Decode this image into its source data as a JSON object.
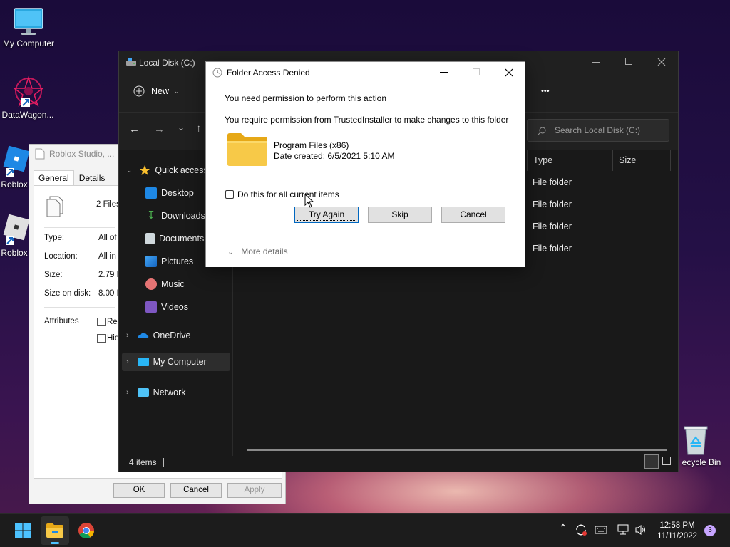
{
  "desktop": {
    "icons": [
      {
        "label": "My Computer"
      },
      {
        "label": "DataWagon..."
      },
      {
        "label": "Roblox"
      },
      {
        "label": "Roblox"
      },
      {
        "label": "ecycle Bin"
      }
    ]
  },
  "properties_dialog": {
    "title": "Roblox Studio, ...",
    "tabs": [
      "General",
      "Details"
    ],
    "summary": "2 Files,",
    "rows": [
      {
        "label": "Type:",
        "value": "All of t"
      },
      {
        "label": "Location:",
        "value": "All in C"
      },
      {
        "label": "Size:",
        "value": "2.79 K"
      },
      {
        "label": "Size on disk:",
        "value": "8.00 K"
      }
    ],
    "attributes_label": "Attributes",
    "attr_readonly": "Rea",
    "attr_hidden": "Hidd",
    "buttons": {
      "ok": "OK",
      "cancel": "Cancel",
      "apply": "Apply"
    }
  },
  "explorer": {
    "title": "Local Disk (C:)",
    "toolbar": {
      "new_label": "New",
      "more_label": "•••"
    },
    "search_placeholder": "Search Local Disk (C:)",
    "columns": {
      "type": "Type",
      "size": "Size"
    },
    "rows": [
      {
        "type": "File folder"
      },
      {
        "type": "File folder"
      },
      {
        "type": "File folder"
      },
      {
        "type": "File folder"
      }
    ],
    "sidebar": {
      "quick_access": "Quick access",
      "items": [
        "Desktop",
        "Downloads",
        "Documents",
        "Pictures",
        "Music",
        "Videos"
      ],
      "onedrive": "OneDrive",
      "my_computer": "My Computer",
      "network": "Network"
    },
    "status": "4 items"
  },
  "dialog": {
    "title": "Folder Access Denied",
    "heading": "You need permission to perform this action",
    "message": "You require permission from TrustedInstaller to make changes to this folder",
    "item_name": "Program Files (x86)",
    "item_date": "Date created: 6/5/2021 5:10 AM",
    "checkbox_label": "Do this for all current items",
    "buttons": {
      "try_again": "Try Again",
      "skip": "Skip",
      "cancel": "Cancel"
    },
    "more_details": "More details"
  },
  "taskbar": {
    "time": "12:58 PM",
    "date": "11/11/2022",
    "notification_count": "3"
  },
  "colors": {
    "accent": "#0067c0",
    "folder_yellow": "#f7c948",
    "explorer_bg": "#191919"
  }
}
